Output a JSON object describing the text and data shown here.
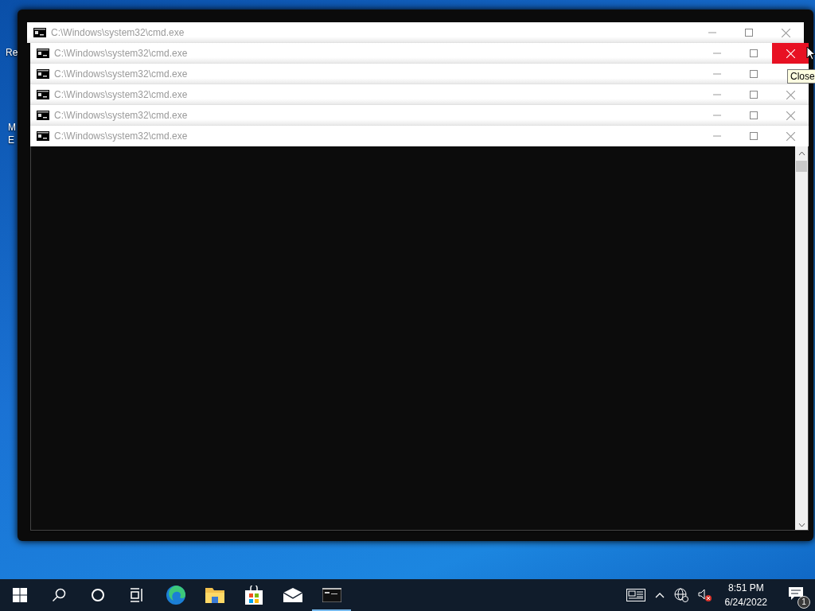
{
  "desktop_icons": [
    {
      "label_lines": [
        "Re"
      ]
    },
    {
      "label_lines": [
        "M",
        "E"
      ]
    }
  ],
  "windows": [
    {
      "title": "C:\\Windows\\system32\\cmd.exe",
      "close_hovered": false
    },
    {
      "title": "C:\\Windows\\system32\\cmd.exe",
      "close_hovered": true
    },
    {
      "title": "C:\\Windows\\system32\\cmd.exe",
      "close_hovered": false
    },
    {
      "title": "C:\\Windows\\system32\\cmd.exe",
      "close_hovered": false
    },
    {
      "title": "C:\\Windows\\system32\\cmd.exe",
      "close_hovered": false
    },
    {
      "title": "C:\\Windows\\system32\\cmd.exe",
      "close_hovered": false
    }
  ],
  "tooltip": "Close",
  "taskbar": {
    "apps": [
      {
        "kind": "start"
      },
      {
        "kind": "search"
      },
      {
        "kind": "cortana"
      },
      {
        "kind": "taskview"
      },
      {
        "kind": "edge"
      },
      {
        "kind": "explorer"
      },
      {
        "kind": "store"
      },
      {
        "kind": "mail"
      },
      {
        "kind": "cmd",
        "running": true
      }
    ],
    "clock_time": "8:51 PM",
    "clock_date": "6/24/2022",
    "notification_count": "1"
  }
}
